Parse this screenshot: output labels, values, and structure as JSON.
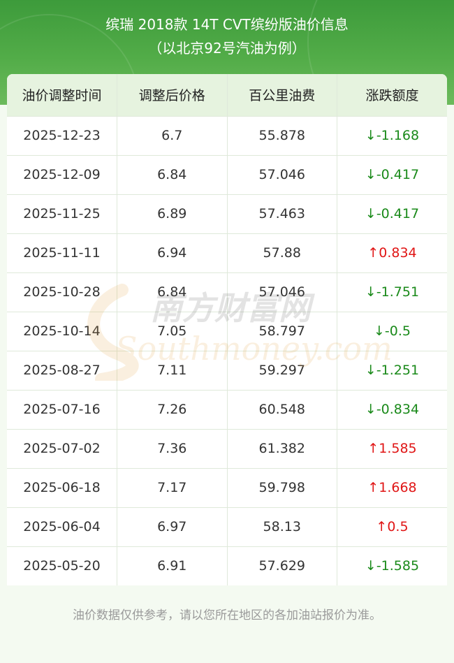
{
  "header": {
    "title": "缤瑞 2018款 14T CVT缤纷版油价信息",
    "subtitle": "（以北京92号汽油为例）"
  },
  "table": {
    "columns": [
      "油价调整时间",
      "调整后价格",
      "百公里油费",
      "涨跌额度"
    ],
    "rows": [
      {
        "date": "2025-12-23",
        "price": "6.7",
        "cost": "55.878",
        "change": "↓-1.168",
        "dir": "down"
      },
      {
        "date": "2025-12-09",
        "price": "6.84",
        "cost": "57.046",
        "change": "↓-0.417",
        "dir": "down"
      },
      {
        "date": "2025-11-25",
        "price": "6.89",
        "cost": "57.463",
        "change": "↓-0.417",
        "dir": "down"
      },
      {
        "date": "2025-11-11",
        "price": "6.94",
        "cost": "57.88",
        "change": "↑0.834",
        "dir": "up"
      },
      {
        "date": "2025-10-28",
        "price": "6.84",
        "cost": "57.046",
        "change": "↓-1.751",
        "dir": "down"
      },
      {
        "date": "2025-10-14",
        "price": "7.05",
        "cost": "58.797",
        "change": "↓-0.5",
        "dir": "down"
      },
      {
        "date": "2025-08-27",
        "price": "7.11",
        "cost": "59.297",
        "change": "↓-1.251",
        "dir": "down"
      },
      {
        "date": "2025-07-16",
        "price": "7.26",
        "cost": "60.548",
        "change": "↓-0.834",
        "dir": "down"
      },
      {
        "date": "2025-07-02",
        "price": "7.36",
        "cost": "61.382",
        "change": "↑1.585",
        "dir": "up"
      },
      {
        "date": "2025-06-18",
        "price": "7.17",
        "cost": "59.798",
        "change": "↑1.668",
        "dir": "up"
      },
      {
        "date": "2025-06-04",
        "price": "6.97",
        "cost": "58.13",
        "change": "↑0.5",
        "dir": "up"
      },
      {
        "date": "2025-05-20",
        "price": "6.91",
        "cost": "57.629",
        "change": "↓-1.585",
        "dir": "down"
      }
    ]
  },
  "watermark": {
    "cn": "南方财富网",
    "en": "Southmoney.com"
  },
  "footer": {
    "note": "油价数据仅供参考，请以您所在地区的各加油站报价为准。"
  },
  "colors": {
    "header_green": "#3d9b3b",
    "table_header_bg": "#e6f3df",
    "down": "#1a8a1a",
    "up": "#e01515",
    "page_bg": "#f4faf1"
  }
}
